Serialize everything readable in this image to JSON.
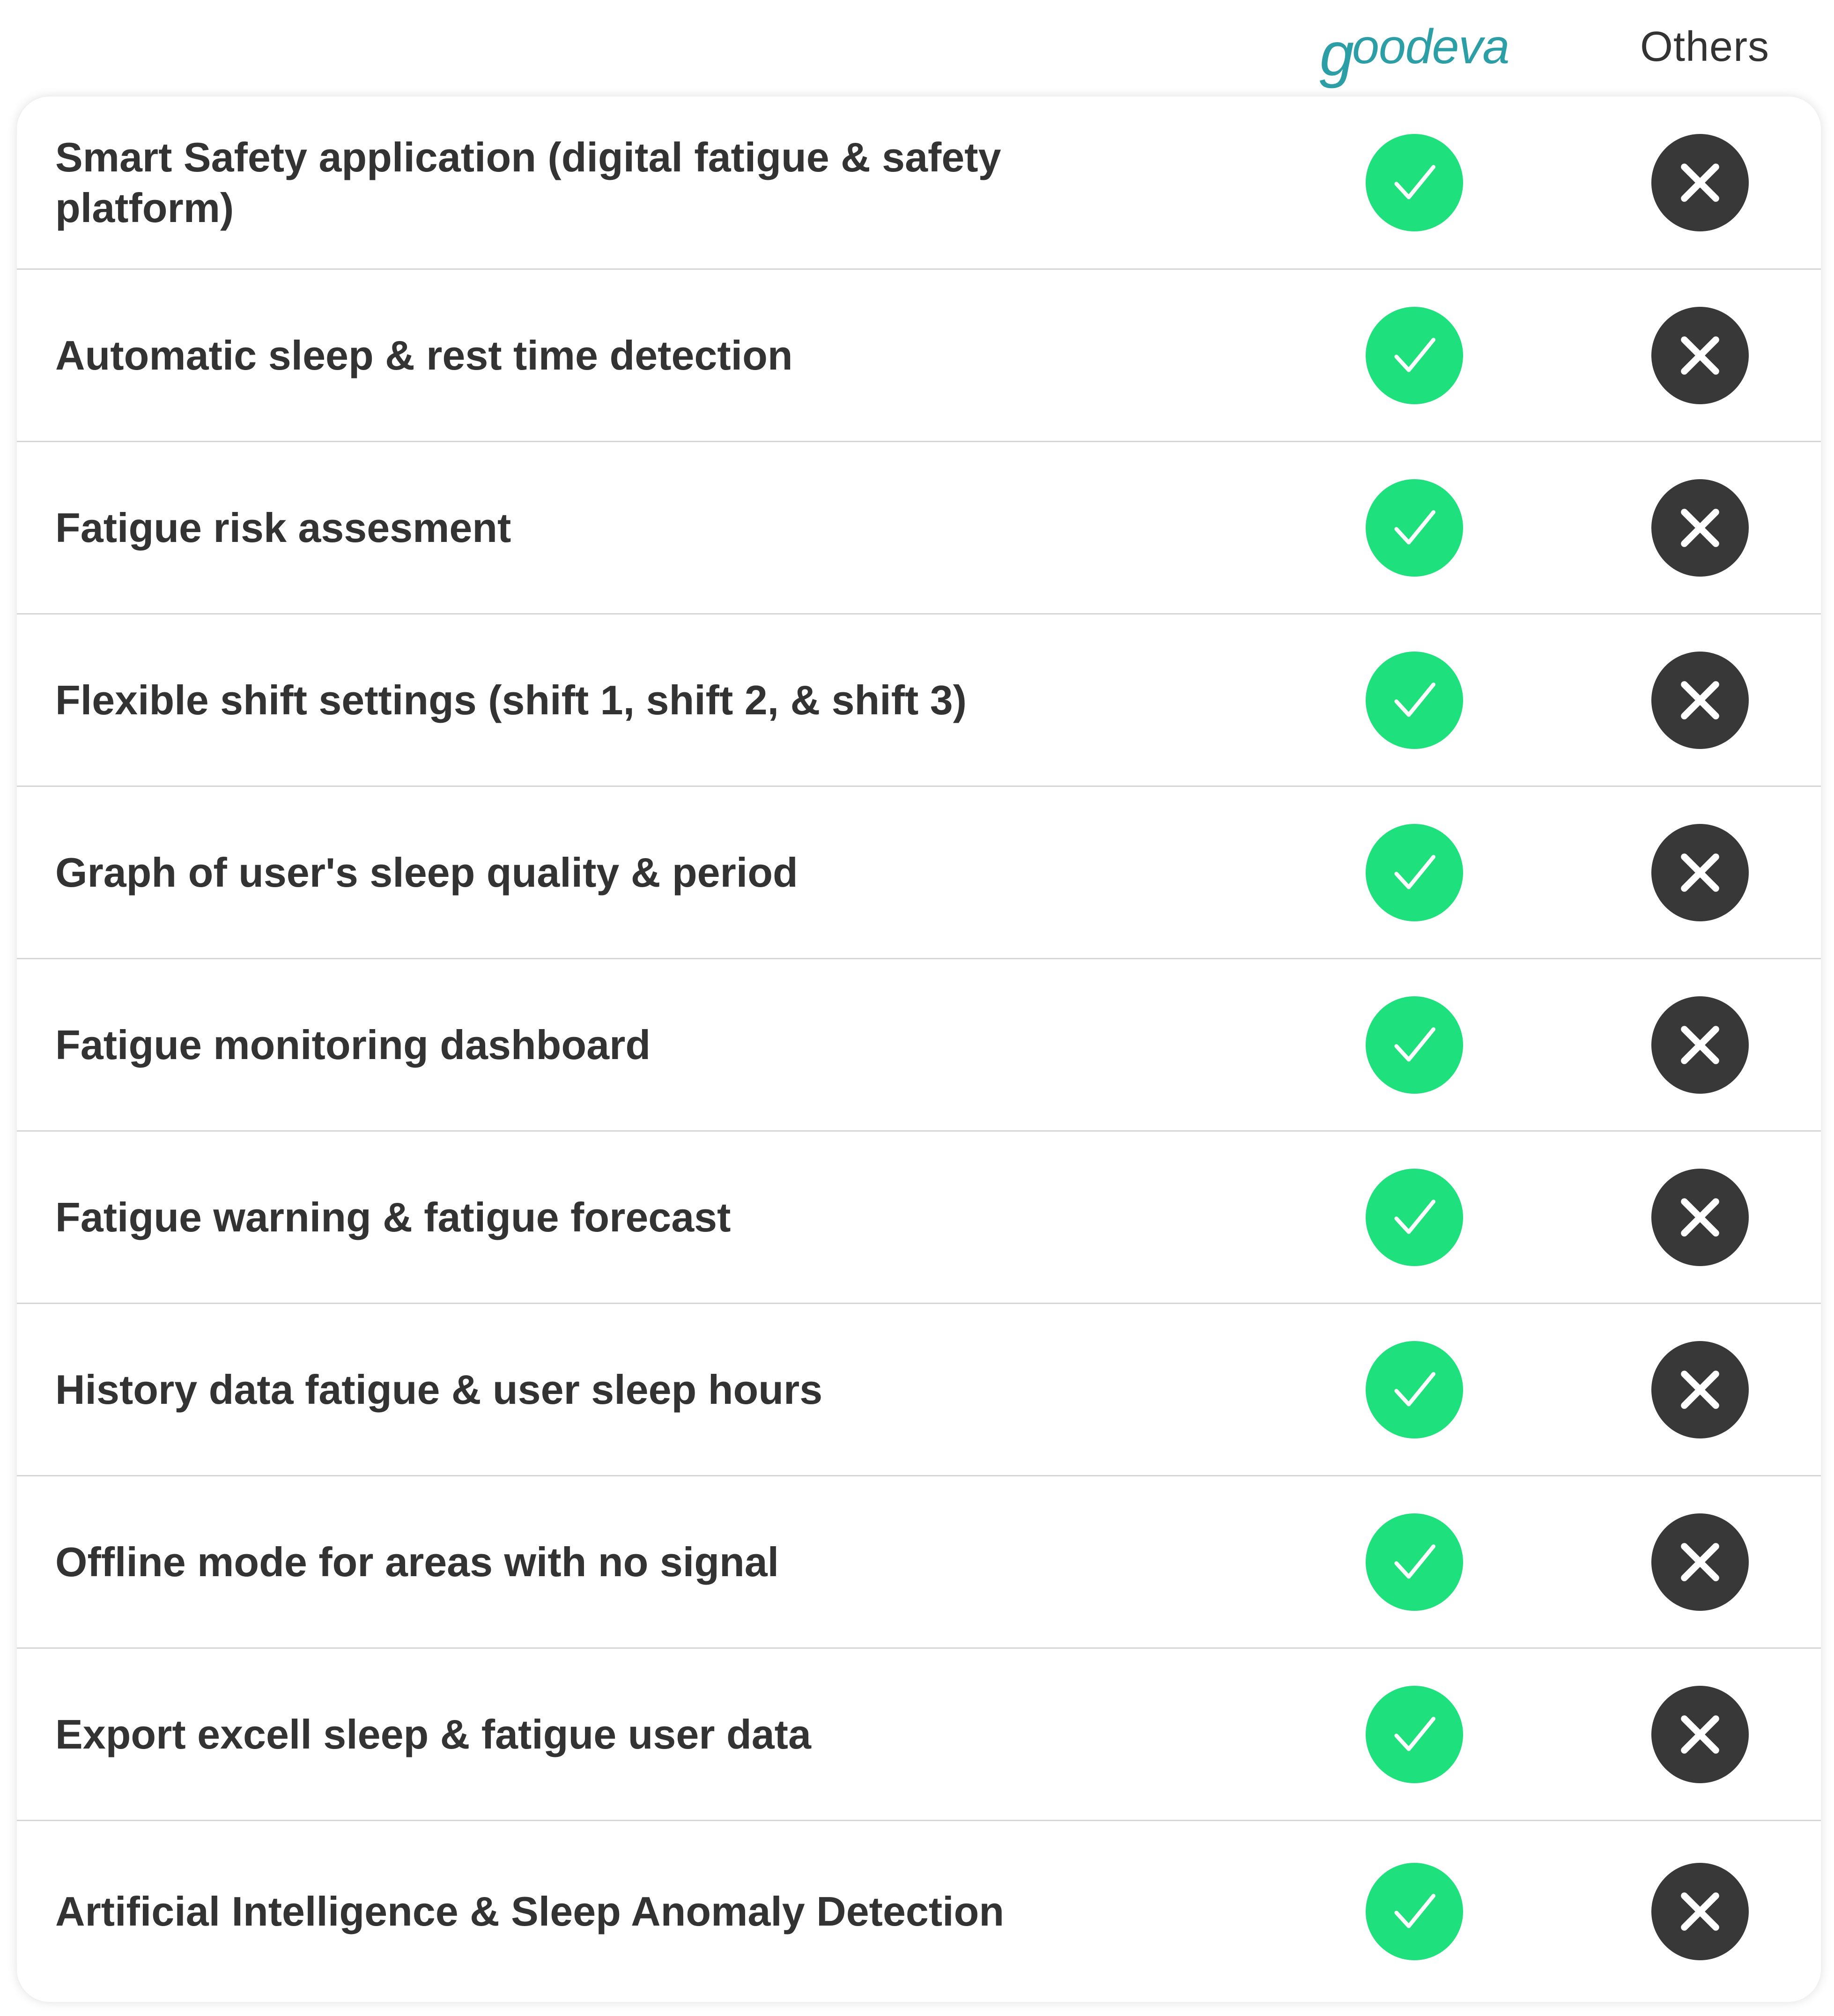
{
  "header": {
    "brand_name": "goodeva",
    "brand_g": "g",
    "brand_rest": "oodeva",
    "brand_color": "#2b9ea6",
    "others_label": "Others"
  },
  "colors": {
    "check_bg": "#1ee07c",
    "cross_bg": "#383838",
    "text": "#333333",
    "divider": "#d6d6d6"
  },
  "icons": {
    "goodeva_column": "check-icon",
    "others_column": "cross-icon"
  },
  "rows": [
    {
      "feature": "Smart Safety application (digital fatigue & safety platform)",
      "goodeva": true,
      "others": false
    },
    {
      "feature": "Automatic sleep & rest time detection",
      "goodeva": true,
      "others": false
    },
    {
      "feature": "Fatigue risk assesment",
      "goodeva": true,
      "others": false
    },
    {
      "feature": "Flexible shift settings (shift 1, shift 2, & shift 3)",
      "goodeva": true,
      "others": false
    },
    {
      "feature": "Graph of user's sleep quality & period",
      "goodeva": true,
      "others": false
    },
    {
      "feature": "Fatigue monitoring dashboard",
      "goodeva": true,
      "others": false
    },
    {
      "feature": "Fatigue warning & fatigue forecast",
      "goodeva": true,
      "others": false
    },
    {
      "feature": "History data fatigue & user sleep hours",
      "goodeva": true,
      "others": false
    },
    {
      "feature": "Offline mode for areas with no signal",
      "goodeva": true,
      "others": false
    },
    {
      "feature": "Export excell sleep & fatigue user data",
      "goodeva": true,
      "others": false
    },
    {
      "feature": "Artificial Intelligence & Sleep Anomaly Detection",
      "goodeva": true,
      "others": false
    }
  ]
}
